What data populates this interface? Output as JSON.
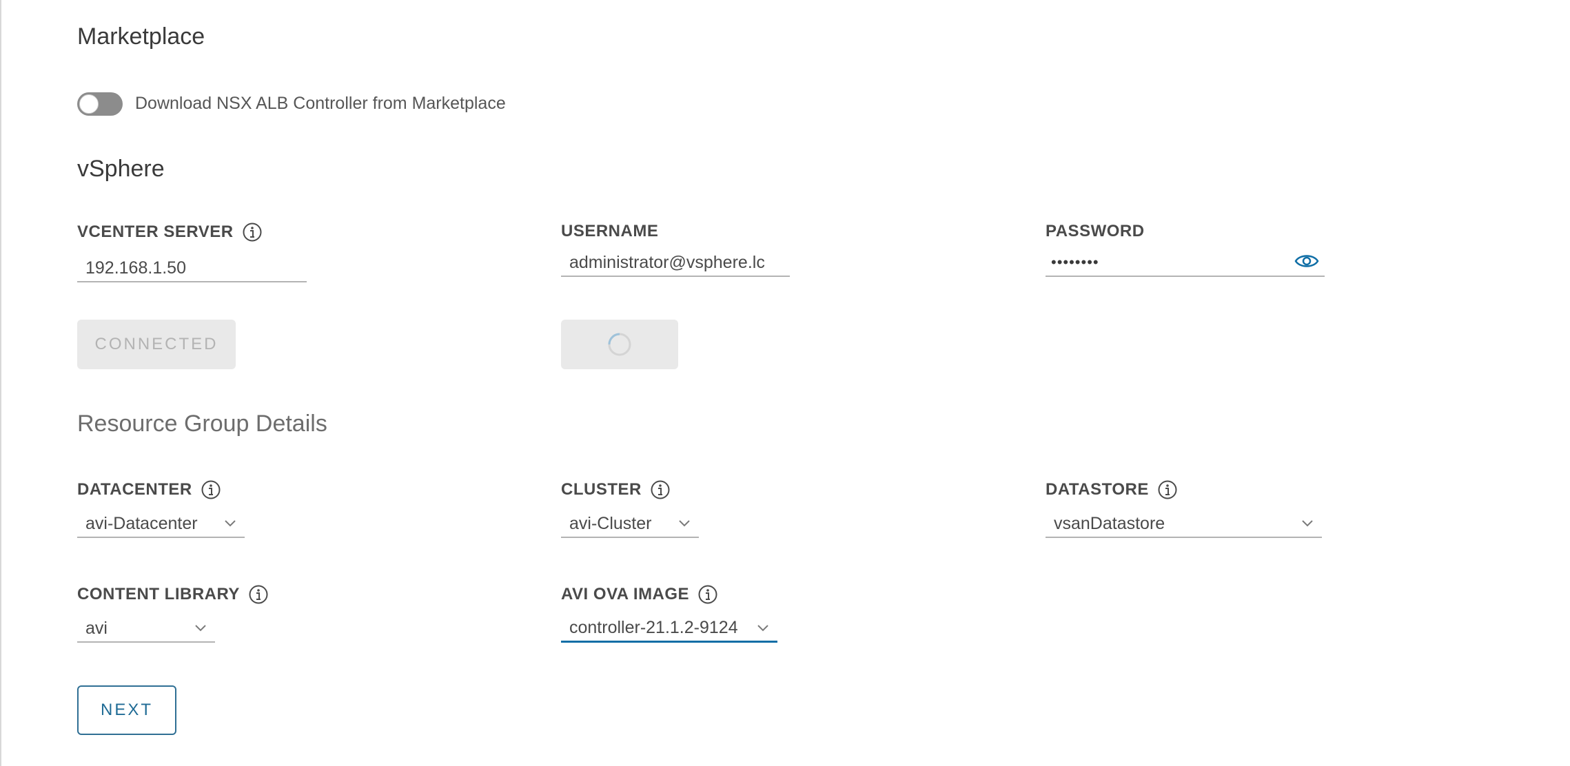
{
  "marketplace": {
    "title": "Marketplace",
    "toggle_label": "Download NSX ALB Controller from Marketplace",
    "toggle_on": false
  },
  "vsphere": {
    "title": "vSphere",
    "vcenter_label": "VCENTER SERVER",
    "vcenter_value": "192.168.1.50",
    "username_label": "USERNAME",
    "username_value": "administrator@vsphere.lc",
    "password_label": "PASSWORD",
    "password_value": "••••••••",
    "connected_button": "CONNECTED"
  },
  "resource_group": {
    "title": "Resource Group Details",
    "datacenter_label": "DATACENTER",
    "datacenter_value": "avi-Datacenter",
    "cluster_label": "CLUSTER",
    "cluster_value": "avi-Cluster",
    "datastore_label": "DATASTORE",
    "datastore_value": "vsanDatastore",
    "content_library_label": "CONTENT LIBRARY",
    "content_library_value": "avi",
    "ova_label": "AVI OVA IMAGE",
    "ova_value": "controller-21.1.2-9124"
  },
  "actions": {
    "next_label": "NEXT"
  },
  "colors": {
    "accent": "#0f6ea6",
    "button_outline": "#2f6f94",
    "disabled_bg": "#e9e9e9"
  }
}
